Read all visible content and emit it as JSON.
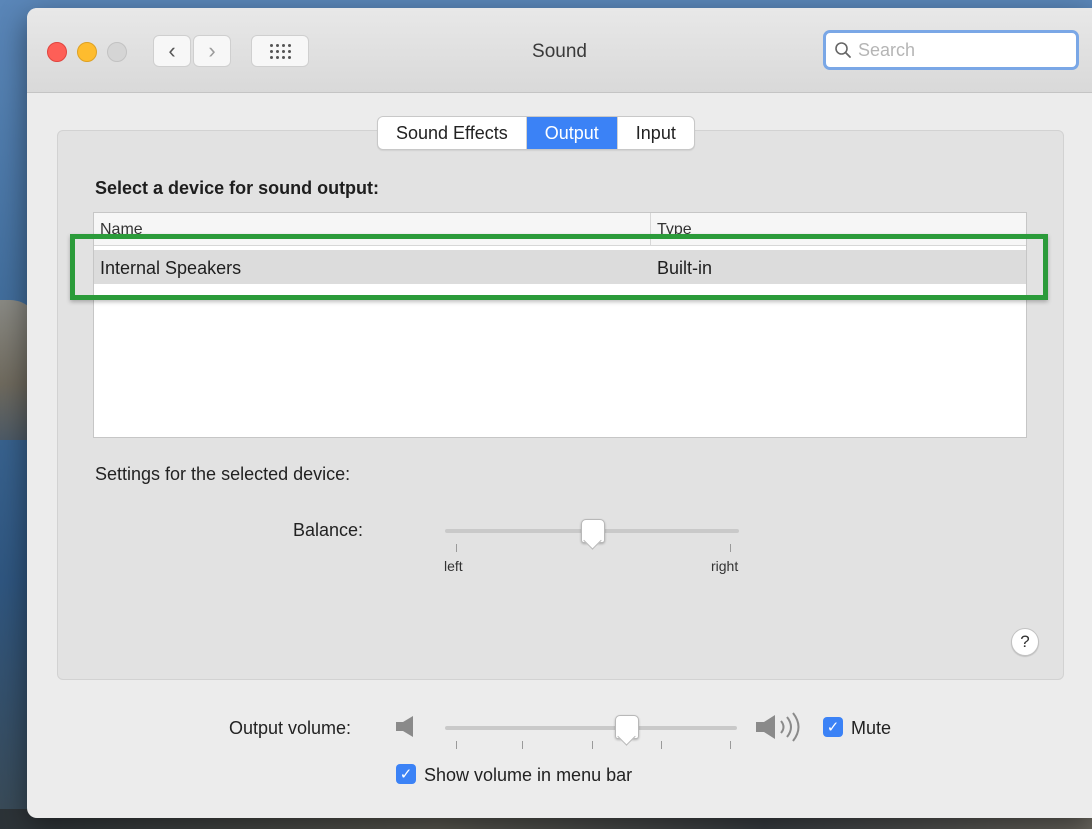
{
  "window": {
    "title": "Sound"
  },
  "search": {
    "placeholder": "Search"
  },
  "tabs": [
    {
      "label": "Sound Effects",
      "active": false
    },
    {
      "label": "Output",
      "active": true
    },
    {
      "label": "Input",
      "active": false
    }
  ],
  "output": {
    "heading": "Select a device for sound output:",
    "columns": {
      "name": "Name",
      "type": "Type"
    },
    "devices": [
      {
        "name": "Internal Speakers",
        "type": "Built-in"
      }
    ],
    "settings_heading": "Settings for the selected device:",
    "balance": {
      "label": "Balance:",
      "left_label": "left",
      "right_label": "right",
      "value": 0.5
    }
  },
  "volume": {
    "label": "Output volume:",
    "value": 0.62,
    "mute_label": "Mute",
    "mute_checked": true,
    "show_in_menu_label": "Show volume in menu bar",
    "show_in_menu_checked": true
  },
  "help": {
    "label": "?"
  },
  "colors": {
    "accent": "#3b82f6",
    "highlight": "#2b9b3a"
  }
}
